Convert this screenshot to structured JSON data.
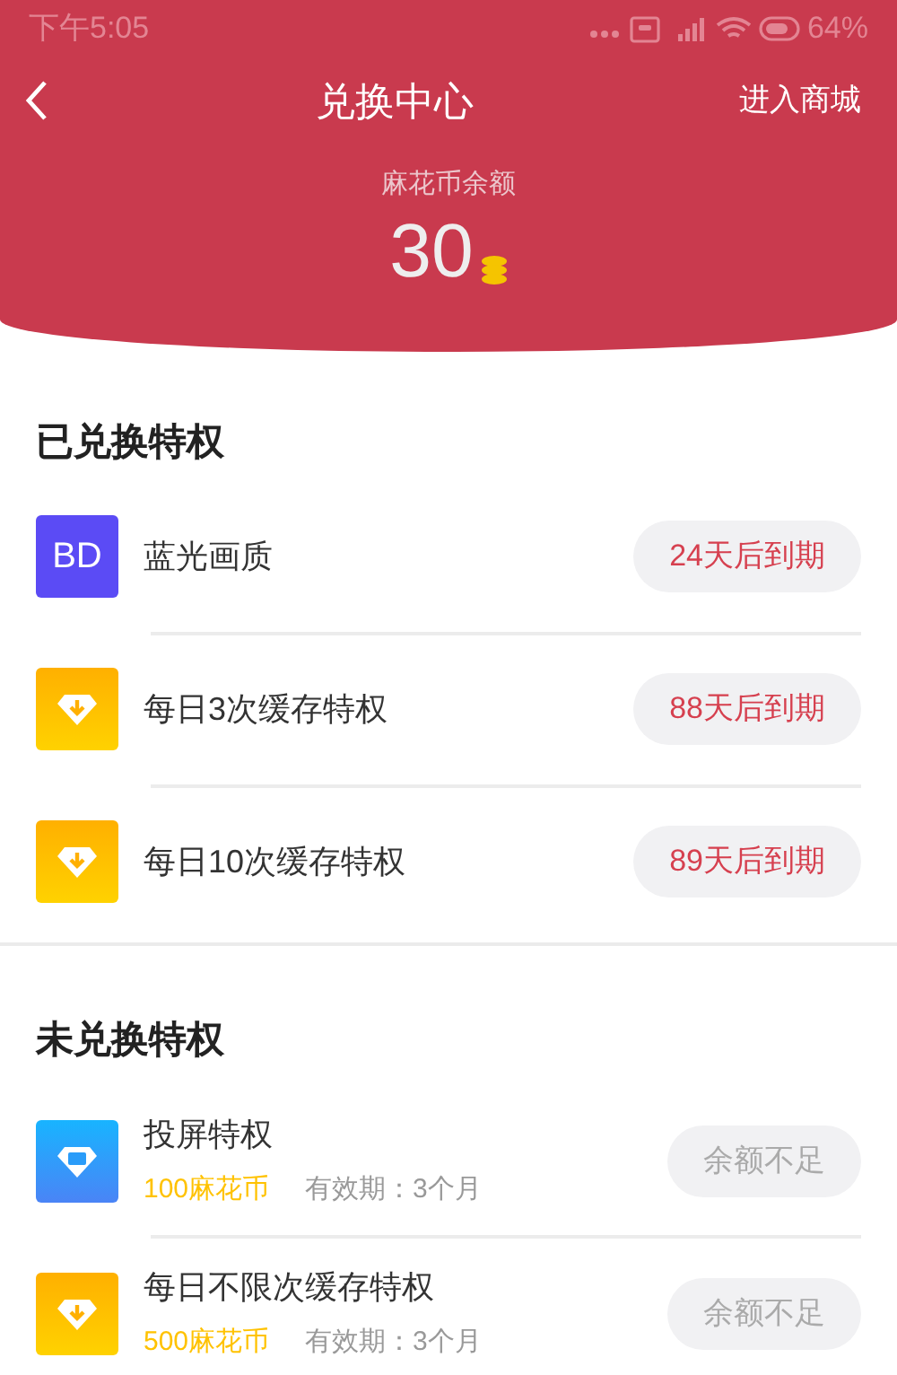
{
  "status_bar": {
    "time": "下午5:05",
    "battery": "64%"
  },
  "header": {
    "title": "兑换中心",
    "action": "进入商城"
  },
  "balance": {
    "label": "麻花币余额",
    "amount": "30"
  },
  "redeemed": {
    "title": "已兑换特权",
    "items": [
      {
        "kind": "badge",
        "badge_text": "BD",
        "name": "蓝光画质",
        "expiry": "24天后到期"
      },
      {
        "kind": "download",
        "name": "每日3次缓存特权",
        "expiry": "88天后到期"
      },
      {
        "kind": "download",
        "name": "每日10次缓存特权",
        "expiry": "89天后到期"
      }
    ]
  },
  "unredeemed": {
    "title": "未兑换特权",
    "items": [
      {
        "kind": "screen",
        "name": "投屏特权",
        "price": "100麻花币",
        "validity": "有效期：3个月",
        "button": "余额不足",
        "disabled": true
      },
      {
        "kind": "download",
        "name": "每日不限次缓存特权",
        "price": "500麻花币",
        "validity": "有效期：3个月",
        "button": "余额不足",
        "disabled": true
      }
    ]
  }
}
